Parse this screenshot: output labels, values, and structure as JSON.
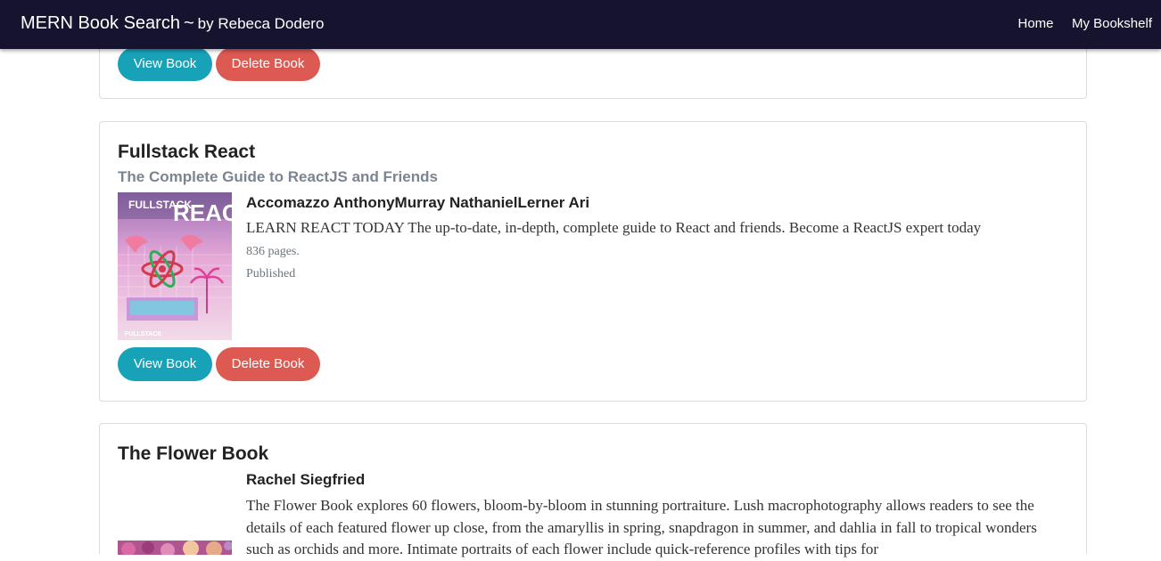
{
  "navbar": {
    "brand": "MERN Book Search",
    "tilde": "~",
    "byline": "by Rebeca Dodero",
    "links": [
      "Home",
      "My Bookshelf"
    ]
  },
  "buttons": {
    "view": "View Book",
    "delete": "Delete Book"
  },
  "books": [
    {
      "title": "Fullstack React",
      "subtitle": "The Complete Guide to ReactJS and Friends",
      "authors": "Accomazzo AnthonyMurray NathanielLerner Ari",
      "description": "LEARN REACT TODAY The up-to-date, in-depth, complete guide to React and friends. Become a ReactJS expert today",
      "pages": "836 pages.",
      "status": "Published",
      "cover": {
        "title_top": "FULLSTACK",
        "title_big": "REACT",
        "publisher": "FULLSTACK"
      }
    },
    {
      "title": "The Flower Book",
      "authors": "Rachel Siegfried",
      "description": "The Flower Book explores 60 flowers, bloom-by-bloom in stunning portraiture. Lush macrophotography allows readers to see the details of each featured flower up close, from the amaryllis in spring, snapdragon in summer, and dahlia in fall to tropical wonders such as orchids and more. Intimate portraits of each flower include quick-reference profiles with tips for"
    }
  ],
  "colors": {
    "navbar": "#16132f",
    "view_button": "#17a2b8",
    "delete_button": "#dc5a52",
    "subtitle": "#7b8591"
  }
}
